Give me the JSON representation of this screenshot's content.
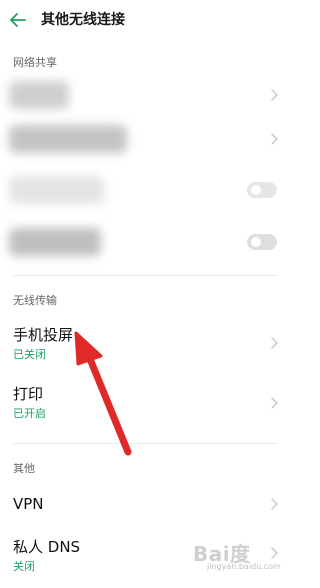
{
  "header": {
    "title": "其他无线连接",
    "back_icon": "back-arrow-icon"
  },
  "sections": {
    "network_share": {
      "title": "网络共享"
    },
    "wireless_transfer": {
      "title": "无线传输",
      "items": [
        {
          "label": "手机投屏",
          "status": "已关闭"
        },
        {
          "label": "打印",
          "status": "已开启"
        }
      ]
    },
    "other": {
      "title": "其他",
      "items": [
        {
          "label": "VPN"
        },
        {
          "label": "私人 DNS",
          "status": "关闭"
        }
      ]
    }
  },
  "colors": {
    "accent": "#1fa060",
    "arrow": "#e02a2a"
  },
  "watermark": {
    "brand": "Bai度",
    "url": "jingyan.baidu.com"
  }
}
